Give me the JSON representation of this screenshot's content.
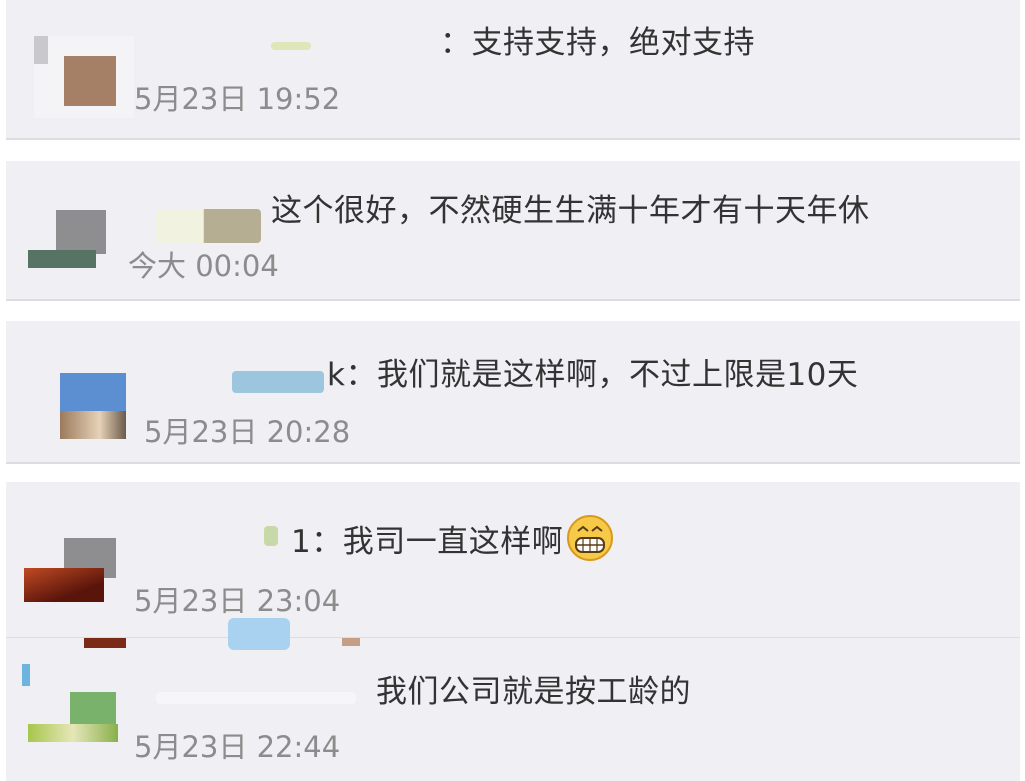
{
  "comments": [
    {
      "text": "：支持支持，绝对支持",
      "time": "5月23日 19:52"
    },
    {
      "text": "这个很好，不然硬生生满十年才有十天年休",
      "time": "今大 00:04"
    },
    {
      "text": "k：我们就是这样啊，不过上限是10天",
      "time": "5月23日 20:28"
    },
    {
      "text": "1：我司一直这样啊",
      "time": "5月23日 23:04",
      "emoji": "grinning-face-icon"
    },
    {
      "text": "我们公司就是按工龄的",
      "time": "5月23日 22:44"
    }
  ],
  "colors": {
    "card_bg": "#efeff4",
    "text": "#333333",
    "time": "#8c8c8c"
  }
}
